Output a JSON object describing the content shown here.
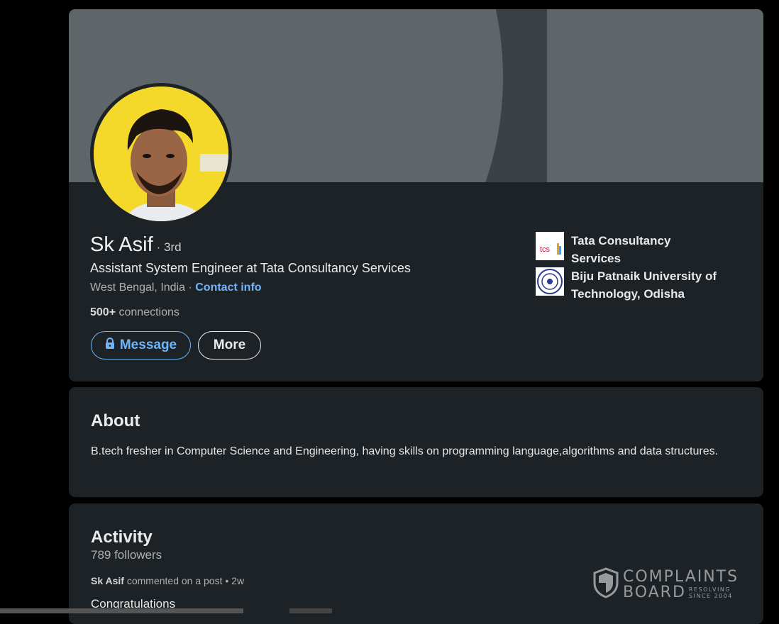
{
  "profile": {
    "name": "Sk Asif",
    "degree": "· 3rd",
    "headline": "Assistant System Engineer at Tata Consultancy Services",
    "location": "West Bengal, India ·",
    "contact_info": "Contact info",
    "connections_count": "500+",
    "connections_label": "connections",
    "message_button": "Message",
    "more_button": "More",
    "organizations": [
      {
        "name": "Tata Consultancy Services",
        "logo": "tcs-logo",
        "logo_text": "tcs"
      },
      {
        "name": "Biju Patnaik University of Technology, Odisha",
        "logo": "bput-seal-logo"
      }
    ]
  },
  "about": {
    "title": "About",
    "text": "B.tech fresher in Computer Science and Engineering, having skills on programming language,algorithms and data structures."
  },
  "activity": {
    "title": "Activity",
    "followers": "789 followers",
    "post_author": "Sk Asif",
    "post_action": "commented on a post • 2w",
    "post_text": "Congratulations"
  },
  "watermark": {
    "line1": "COMPLAINTS",
    "line2": "BOARD",
    "sub1": "RESOLVING",
    "sub2": "SINCE 2004"
  },
  "colors": {
    "background": "#000000",
    "card": "#1d2226",
    "cover": "#5e6669",
    "link": "#70b5f9",
    "avatar_bg": "#f4d82a"
  }
}
